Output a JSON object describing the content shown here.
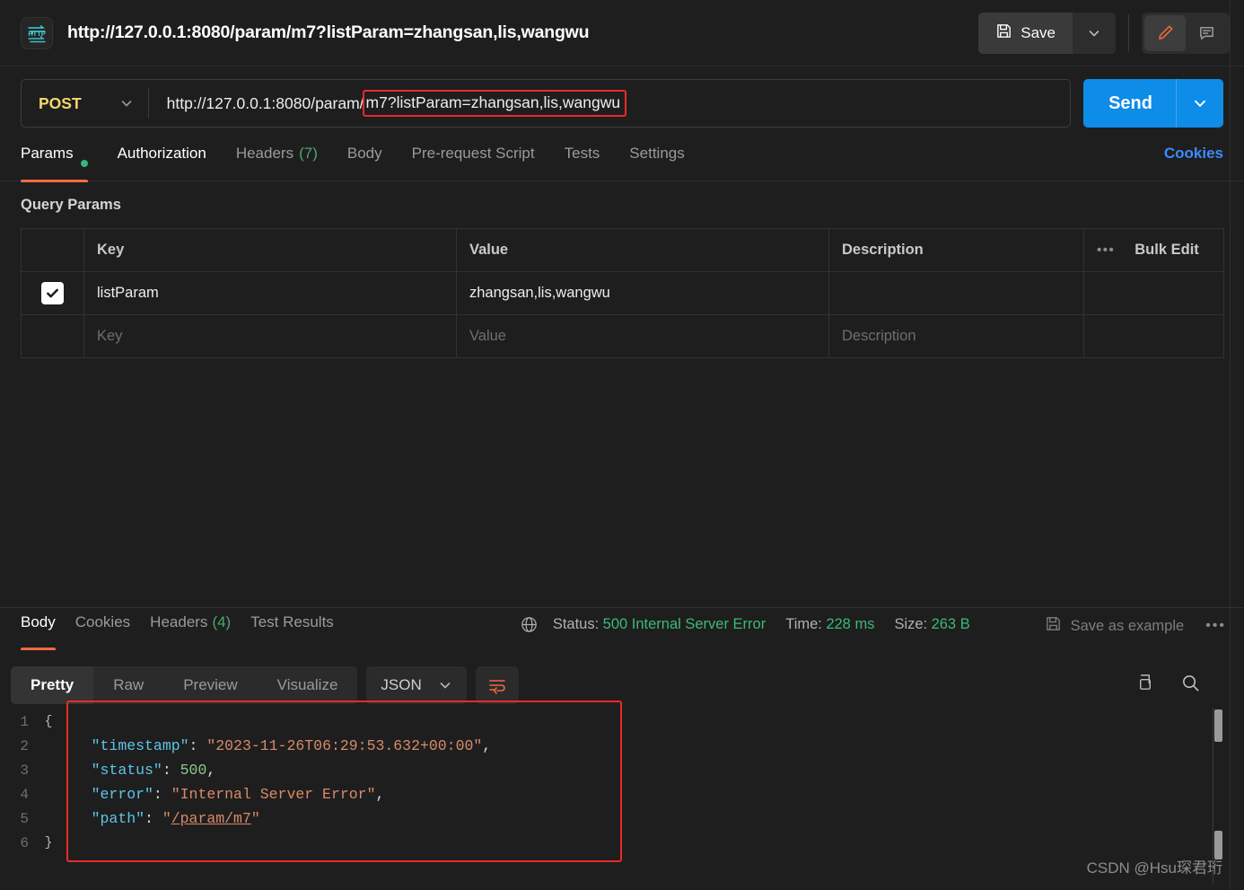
{
  "header": {
    "icon": "http-badge-icon",
    "request_title": "http://127.0.0.1:8080/param/m7?listParam=zhangsan,lis,wangwu",
    "save_label": "Save",
    "save_icon": "floppy-disk-icon",
    "save_caret_icon": "chevron-down-icon",
    "edit_icon": "pencil-icon",
    "comment_icon": "comment-icon"
  },
  "url_bar": {
    "method": "POST",
    "method_caret_icon": "chevron-down-icon",
    "url_prefix": "http://127.0.0.1:8080/param/",
    "url_highlighted": "m7?listParam=zhangsan,lis,wangwu",
    "send_label": "Send",
    "send_caret_icon": "chevron-down-icon"
  },
  "request_tabs": {
    "items": [
      {
        "label": "Params",
        "badge": "",
        "dot": true,
        "active": true
      },
      {
        "label": "Authorization",
        "badge": "",
        "dot": false,
        "active": false
      },
      {
        "label": "Headers",
        "badge": "(7)",
        "dot": false,
        "active": false
      },
      {
        "label": "Body",
        "badge": "",
        "dot": false,
        "active": false
      },
      {
        "label": "Pre-request Script",
        "badge": "",
        "dot": false,
        "active": false
      },
      {
        "label": "Tests",
        "badge": "",
        "dot": false,
        "active": false
      },
      {
        "label": "Settings",
        "badge": "",
        "dot": false,
        "active": false
      }
    ],
    "cookies_link": "Cookies"
  },
  "query_params": {
    "section_title": "Query Params",
    "columns": [
      "Key",
      "Value",
      "Description"
    ],
    "actions": {
      "dots": "•••",
      "bulk_edit": "Bulk Edit"
    },
    "rows": [
      {
        "checked": true,
        "key": "listParam",
        "value": "zhangsan,lis,wangwu",
        "description": ""
      }
    ],
    "placeholder_row": {
      "key": "Key",
      "value": "Value",
      "description": "Description"
    }
  },
  "response": {
    "tabs": [
      {
        "label": "Body",
        "badge": "",
        "active": true
      },
      {
        "label": "Cookies",
        "badge": "",
        "active": false
      },
      {
        "label": "Headers",
        "badge": "(4)",
        "active": false
      },
      {
        "label": "Test Results",
        "badge": "",
        "active": false
      }
    ],
    "globe_icon": "globe-icon",
    "status_label": "Status:",
    "status_value": "500 Internal Server Error",
    "time_label": "Time:",
    "time_value": "228 ms",
    "size_label": "Size:",
    "size_value": "263 B",
    "save_example_label": "Save as example",
    "save_example_icon": "floppy-disk-icon",
    "more_dots": "•••",
    "view_modes": [
      {
        "label": "Pretty",
        "active": true
      },
      {
        "label": "Raw",
        "active": false
      },
      {
        "label": "Preview",
        "active": false
      },
      {
        "label": "Visualize",
        "active": false
      }
    ],
    "format": "JSON",
    "format_caret_icon": "chevron-down-icon",
    "wrap_icon": "word-wrap-icon",
    "copy_icon": "copy-icon",
    "search_icon": "search-icon"
  },
  "code": {
    "lines": [
      {
        "no": "1",
        "fold": "{"
      },
      {
        "no": "2",
        "fold": ""
      },
      {
        "no": "3",
        "fold": ""
      },
      {
        "no": "4",
        "fold": ""
      },
      {
        "no": "5",
        "fold": ""
      },
      {
        "no": "6",
        "fold": "}"
      }
    ],
    "l1": "{",
    "l2_key": "\"timestamp\"",
    "l2_val": "\"2023-11-26T06:29:53.632+00:00\"",
    "l3_key": "\"status\"",
    "l3_val": "500",
    "l4_key": "\"error\"",
    "l4_val": "\"Internal Server Error\"",
    "l5_key": "\"path\"",
    "l5_val": "/param/m7",
    "l6": "}"
  },
  "watermark": "CSDN @Hsu琛君珩",
  "colors": {
    "accent_orange": "#ef6b3f",
    "send_blue": "#0d8ce8",
    "link_blue": "#3d8bfd",
    "status_green": "#3db87a",
    "method_yellow": "#f5d76e",
    "annotation_red": "#ec2a2a",
    "background": "#1e1e1e"
  }
}
